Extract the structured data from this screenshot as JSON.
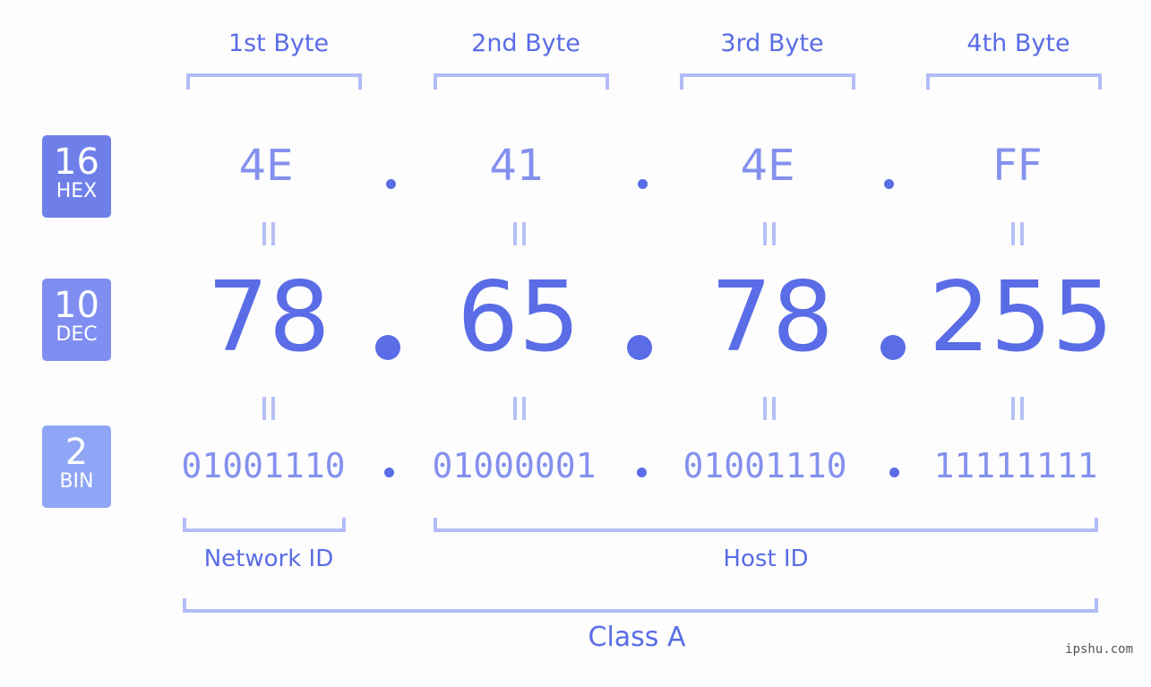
{
  "bytes": [
    {
      "label": "1st Byte",
      "hex": "4E",
      "dec": "78",
      "bin": "01001110"
    },
    {
      "label": "2nd Byte",
      "hex": "41",
      "dec": "65",
      "bin": "01000001"
    },
    {
      "label": "3rd Byte",
      "hex": "4E",
      "dec": "78",
      "bin": "01001110"
    },
    {
      "label": "4th Byte",
      "hex": "FF",
      "dec": "255",
      "bin": "11111111"
    }
  ],
  "badges": {
    "hex": {
      "num": "16",
      "label": "HEX",
      "color": "#6f7fe9"
    },
    "dec": {
      "num": "10",
      "label": "DEC",
      "color": "#7f8ef0"
    },
    "bin": {
      "num": "2",
      "label": "BIN",
      "color": "#8fa5f6"
    }
  },
  "segments": {
    "network": "Network ID",
    "host": "Host ID",
    "class": "Class A"
  },
  "watermark": "ipshu.com"
}
